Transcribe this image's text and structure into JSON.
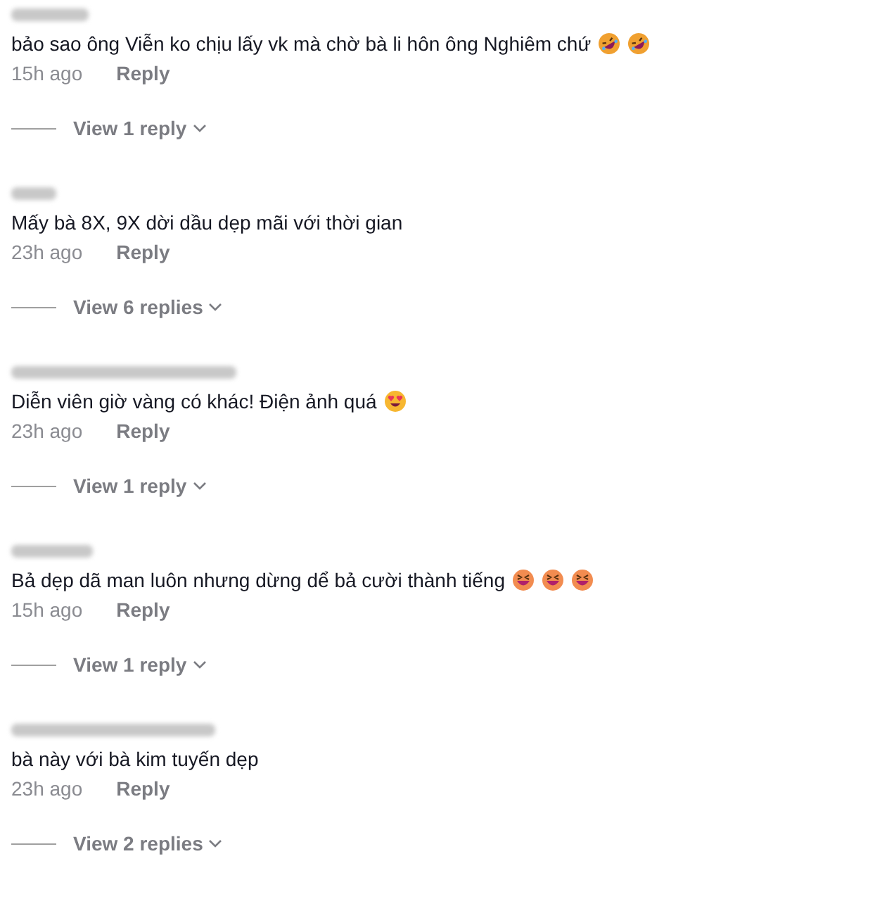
{
  "comments": [
    {
      "text": "bảo sao ông Viễn ko chịu lấy vk mà chờ bà li hôn ông Nghiêm chứ",
      "emojis": [
        {
          "kind": "rofl"
        },
        {
          "kind": "rofl"
        }
      ],
      "time": "15h ago",
      "reply": "Reply",
      "view_replies": "View 1 reply"
    },
    {
      "text": "Mấy bà 8X, 9X dời dầu dẹp mãi với thời gian",
      "time": "23h ago",
      "reply": "Reply",
      "view_replies": "View 6 replies"
    },
    {
      "text": "Diễn viên giờ vàng có khác! Điện ảnh quá",
      "emojis": [
        {
          "kind": "heart-eyes"
        }
      ],
      "time": "23h ago",
      "reply": "Reply",
      "view_replies": "View 1 reply"
    },
    {
      "text": "Bả dẹp dã man luôn nhưng dừng dể bả cười thành tiếng",
      "emojis": [
        {
          "kind": "squint-grin"
        },
        {
          "kind": "squint-grin"
        },
        {
          "kind": "squint-grin"
        }
      ],
      "time": "15h ago",
      "reply": "Reply",
      "view_replies": "View 1 reply"
    },
    {
      "text": "bà này với bà kim tuyến dẹp",
      "time": "23h ago",
      "reply": "Reply",
      "view_replies": "View 2 replies"
    }
  ]
}
